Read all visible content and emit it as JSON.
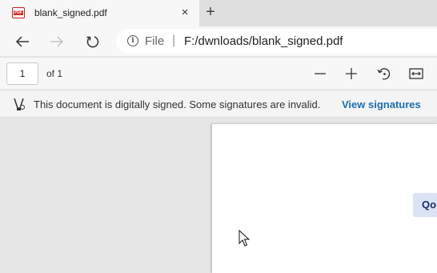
{
  "tab": {
    "favicon_text": "PDF",
    "title": "blank_signed.pdf",
    "close_glyph": "×"
  },
  "newtab_glyph": "+",
  "address": {
    "info_glyph": "i",
    "scheme": "File",
    "separator": "|",
    "url": "F:/dwnloads/blank_signed.pdf"
  },
  "pdf_toolbar": {
    "page_value": "1",
    "page_total": "of 1"
  },
  "signature_bar": {
    "message": "This document is digitally signed. Some signatures are invalid.",
    "link": "View signatures"
  },
  "document": {
    "field_text": "Qo"
  },
  "colors": {
    "link": "#1a6fb3",
    "pdf_red": "#d12b28",
    "signature_field": "#dbe3f4"
  }
}
